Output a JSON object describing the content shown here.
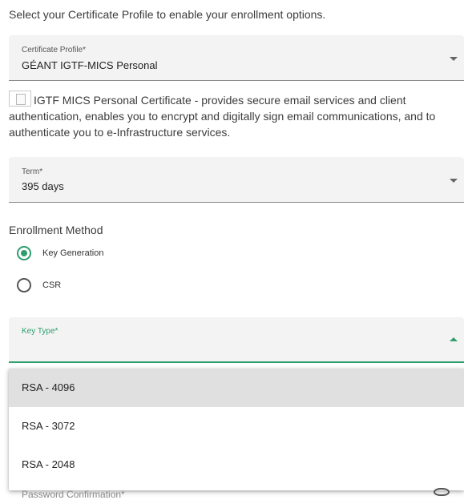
{
  "intro": "Select your Certificate Profile to enable your enrollment options.",
  "certificate_profile": {
    "label": "Certificate Profile*",
    "value": "GÉANT IGTF-MICS Personal"
  },
  "profile_description": "IGTF MICS Personal Certificate - provides secure email services and client authentication, enables you to encrypt and digitally sign email communications, and to authenticate you to e-Infrastructure services.",
  "term": {
    "label": "Term*",
    "value": "395 days"
  },
  "enrollment": {
    "title": "Enrollment Method",
    "options": [
      {
        "label": "Key Generation",
        "selected": true
      },
      {
        "label": "CSR",
        "selected": false
      }
    ]
  },
  "key_type": {
    "label": "Key Type*",
    "value": "",
    "options": [
      "RSA - 4096",
      "RSA - 3072",
      "RSA - 2048"
    ],
    "highlighted": "RSA - 4096"
  },
  "next_field": {
    "label": "Password Confirmation*"
  },
  "colors": {
    "accent": "#2e9e6e",
    "field_bg": "#f3f3f3",
    "highlight_bg": "#e0e0e0"
  }
}
